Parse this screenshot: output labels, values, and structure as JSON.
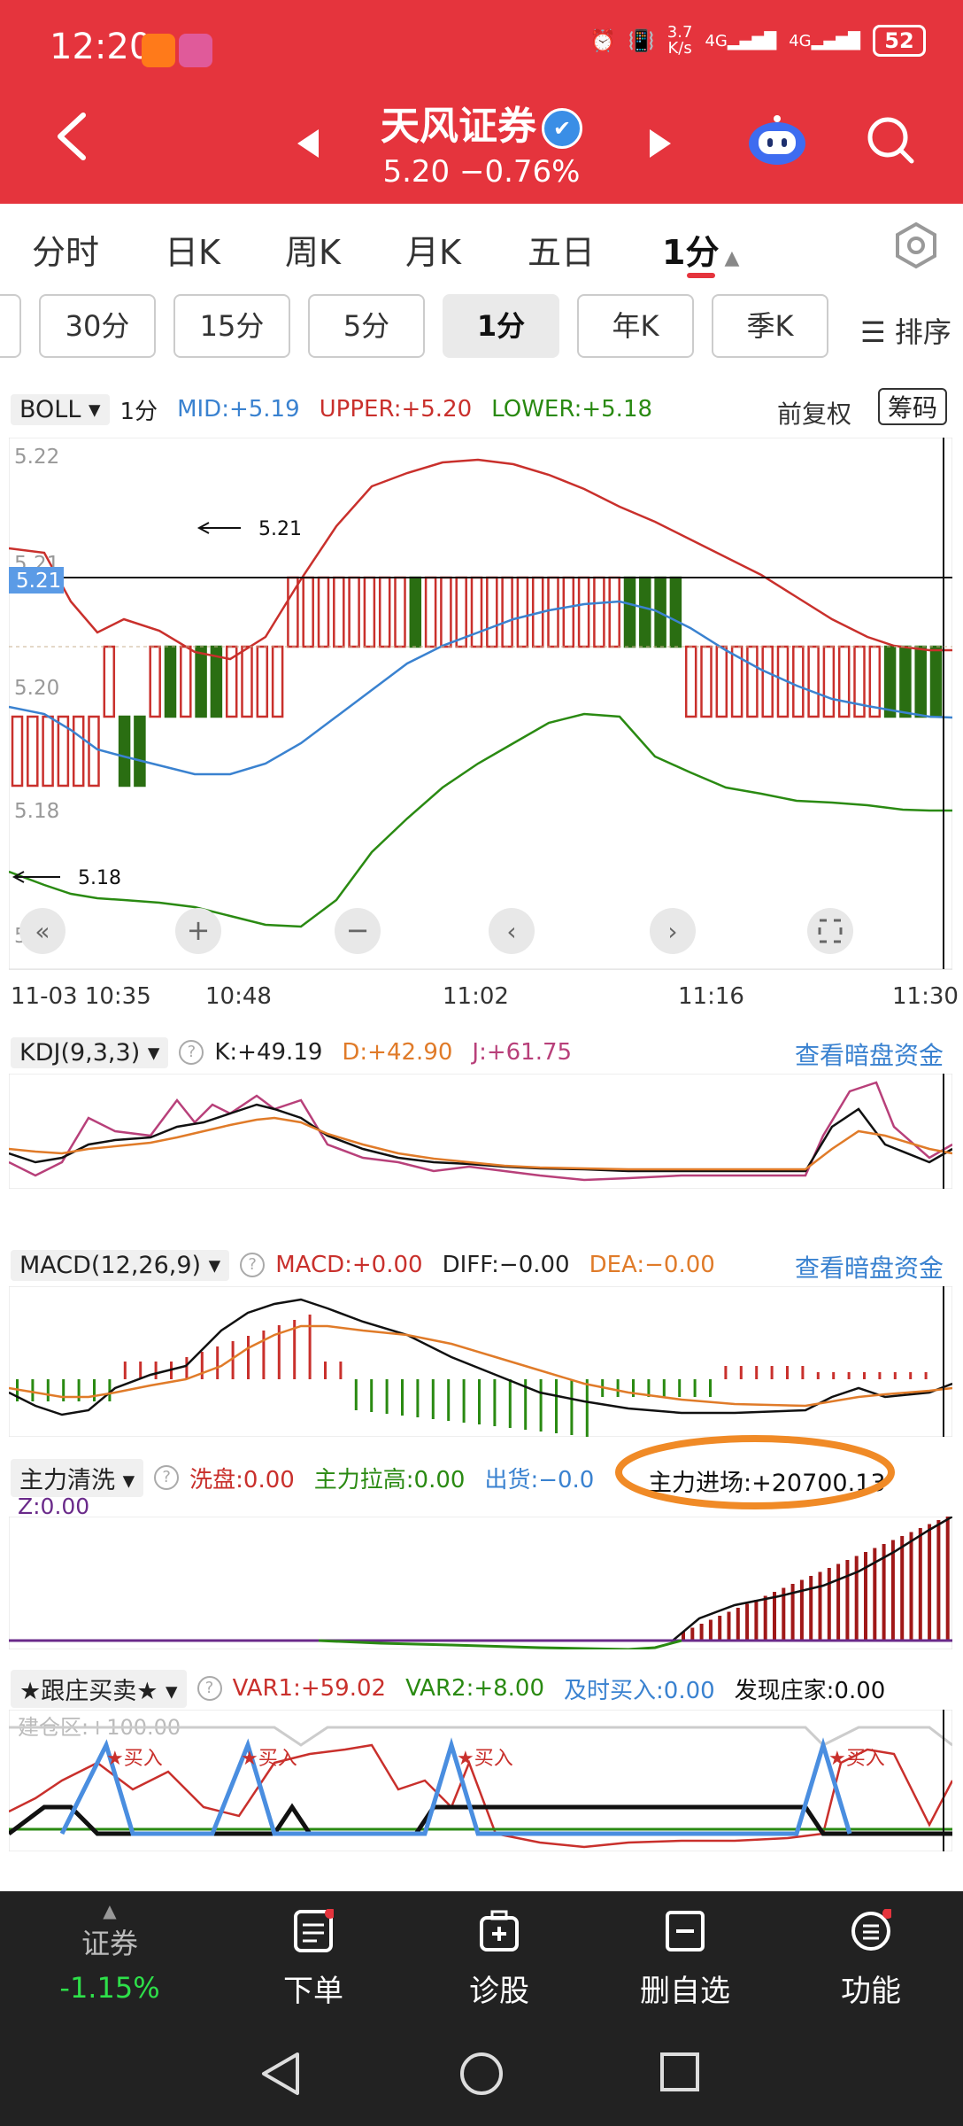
{
  "status_bar": {
    "time": "12:20",
    "net_speed": "3.7\nK/s",
    "sig1": "4G",
    "sig2": "4G",
    "battery": "52"
  },
  "header": {
    "title": "天风证券",
    "verified_mark": "✔",
    "price_line": "5.20  −0.76%"
  },
  "period_tabs": [
    "分时",
    "日K",
    "周K",
    "月K",
    "五日",
    "1分"
  ],
  "active_period_tab": "1分",
  "minute_buttons": [
    "30分",
    "15分",
    "5分",
    "1分",
    "年K",
    "季K"
  ],
  "sort_label": "☰ 排序",
  "main_chart": {
    "indicator": "BOLL",
    "period": "1分",
    "mid": "MID:+5.19",
    "upper": "UPPER:+5.20",
    "lower": "LOWER:+5.18",
    "adjust": "前复权",
    "chips_button": "筹码",
    "y_ticks": [
      "5.22",
      "5.21",
      "5.20",
      "5.18",
      "5.17"
    ],
    "crosshair_price": "5.21",
    "high_marker": "5.21",
    "low_marker": "5.18",
    "x_ticks": [
      "11-03 10:35",
      "10:48",
      "11:02",
      "11:16",
      "11:30"
    ]
  },
  "kdj": {
    "name": "KDJ(9,3,3)",
    "k": "K:+49.19",
    "d": "D:+42.90",
    "j": "J:+61.75",
    "link": "查看暗盘资金"
  },
  "macd": {
    "name": "MACD(12,26,9)",
    "macd": "MACD:+0.00",
    "diff": "DIFF:−0.00",
    "dea": "DEA:−0.00",
    "link": "查看暗盘资金"
  },
  "zlqx": {
    "name": "主力清洗",
    "xipan": "洗盘:0.00",
    "lagao": "主力拉高:0.00",
    "chuhuo": "出货:−0.0",
    "jinchang": "主力进场:+20700.13",
    "z": "Z:0.00"
  },
  "gzmm": {
    "name": "★跟庄买卖★",
    "var1": "VAR1:+59.02",
    "var2": "VAR2:+8.00",
    "jishi": "及时买入:0.00",
    "faxian": "发现庄家:0.00",
    "jiancang": "建仓区:+100.00",
    "buy_label": "★买入"
  },
  "bottom_nav": {
    "market_label": "证券",
    "market_change": "-1.15%",
    "items": [
      "下单",
      "诊股",
      "删自选",
      "功能"
    ]
  },
  "colors": {
    "brand_red": "#e5343d",
    "up_red": "#c9302c",
    "down_green": "#2a6e12",
    "mid_blue": "#3a82d0"
  }
}
